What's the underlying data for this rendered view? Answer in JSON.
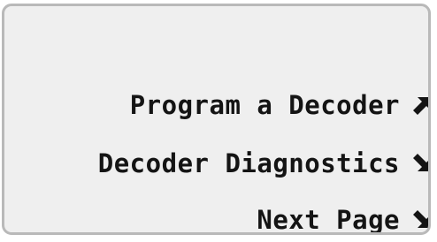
{
  "menu": {
    "items": [
      {
        "label": "Program a Decoder",
        "icon": "arrow-up-right-icon"
      },
      {
        "label": "Decoder Diagnostics",
        "icon": "arrow-down-right-icon"
      },
      {
        "label": "Next Page",
        "icon": "arrow-down-right-icon"
      }
    ]
  },
  "colors": {
    "screen_bg": "#efefef",
    "border": "#b9b9b9",
    "text": "#141414"
  }
}
